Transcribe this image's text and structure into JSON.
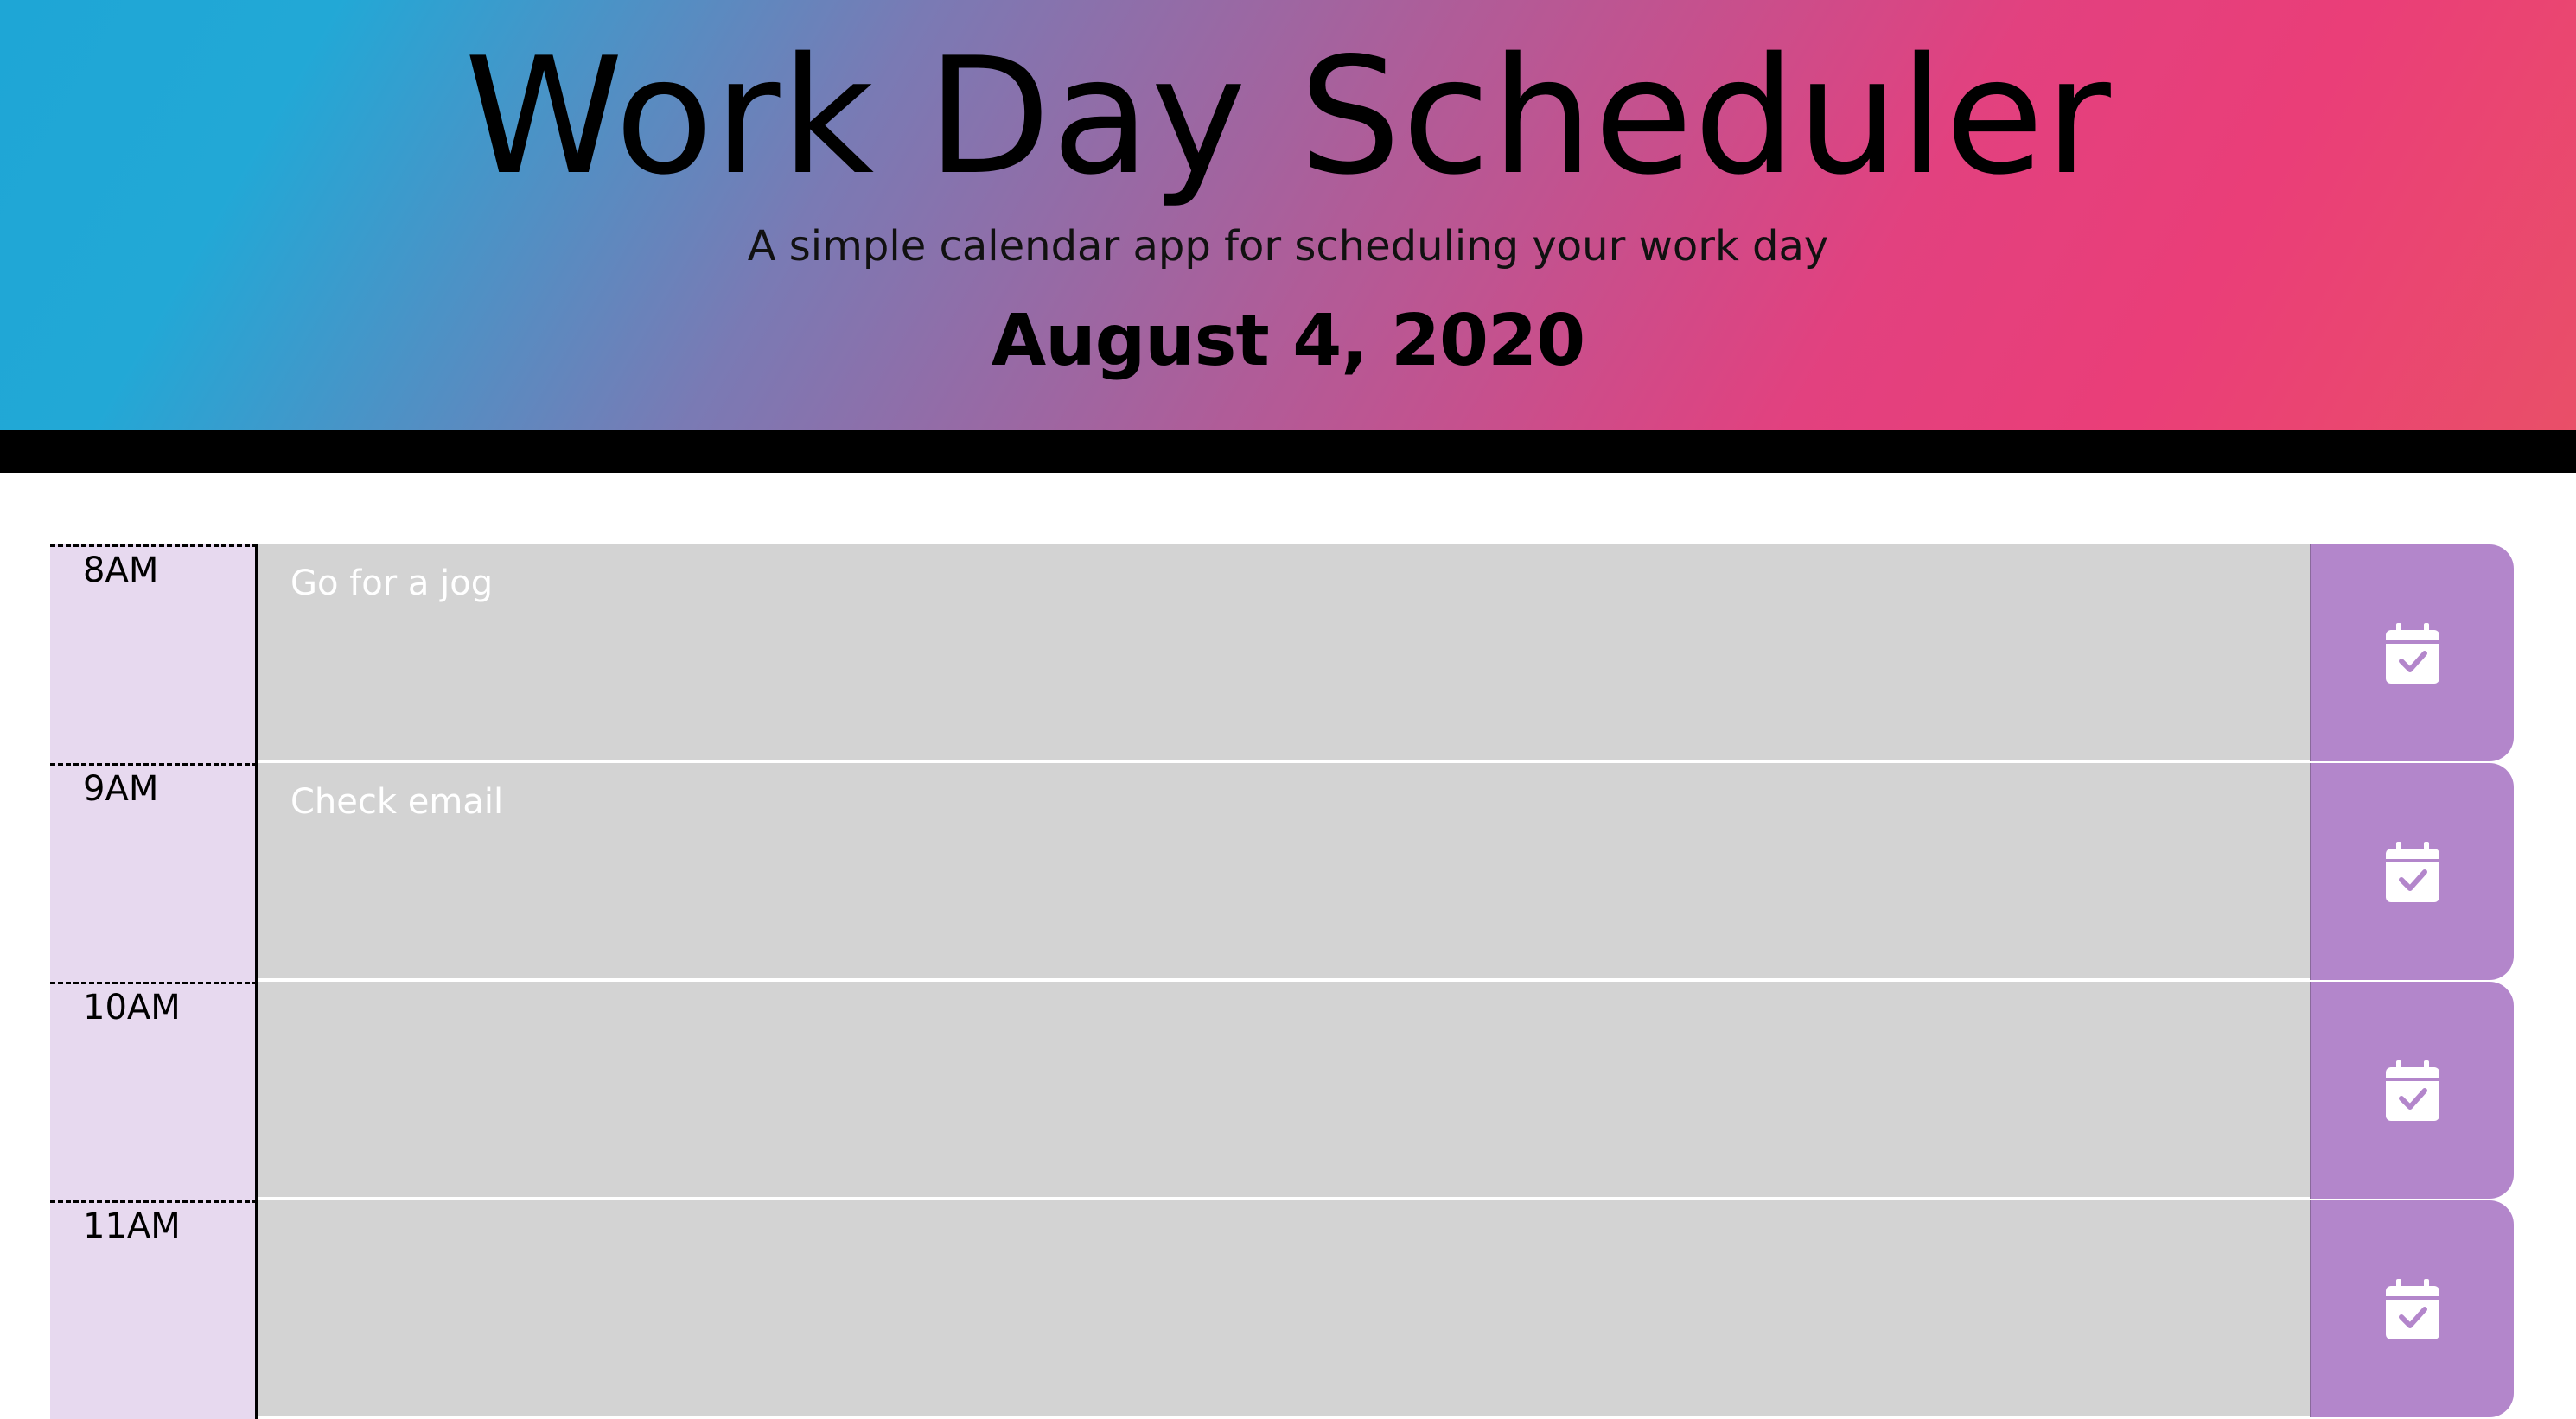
{
  "header": {
    "title": "Work Day Scheduler",
    "subtitle": "A simple calendar app for scheduling your work day",
    "date": "August 4, 2020"
  },
  "colors": {
    "hour_bg": "#e7d9ef",
    "description_bg": "#d3d3d3",
    "save_bg": "#b386cb",
    "divider": "#000000"
  },
  "rows": [
    {
      "hour": "8AM",
      "text": "Go for a jog",
      "save_icon": "calendar-check-icon"
    },
    {
      "hour": "9AM",
      "text": "Check email",
      "save_icon": "calendar-check-icon"
    },
    {
      "hour": "10AM",
      "text": "",
      "save_icon": "calendar-check-icon"
    },
    {
      "hour": "11AM",
      "text": "",
      "save_icon": "calendar-check-icon"
    }
  ]
}
